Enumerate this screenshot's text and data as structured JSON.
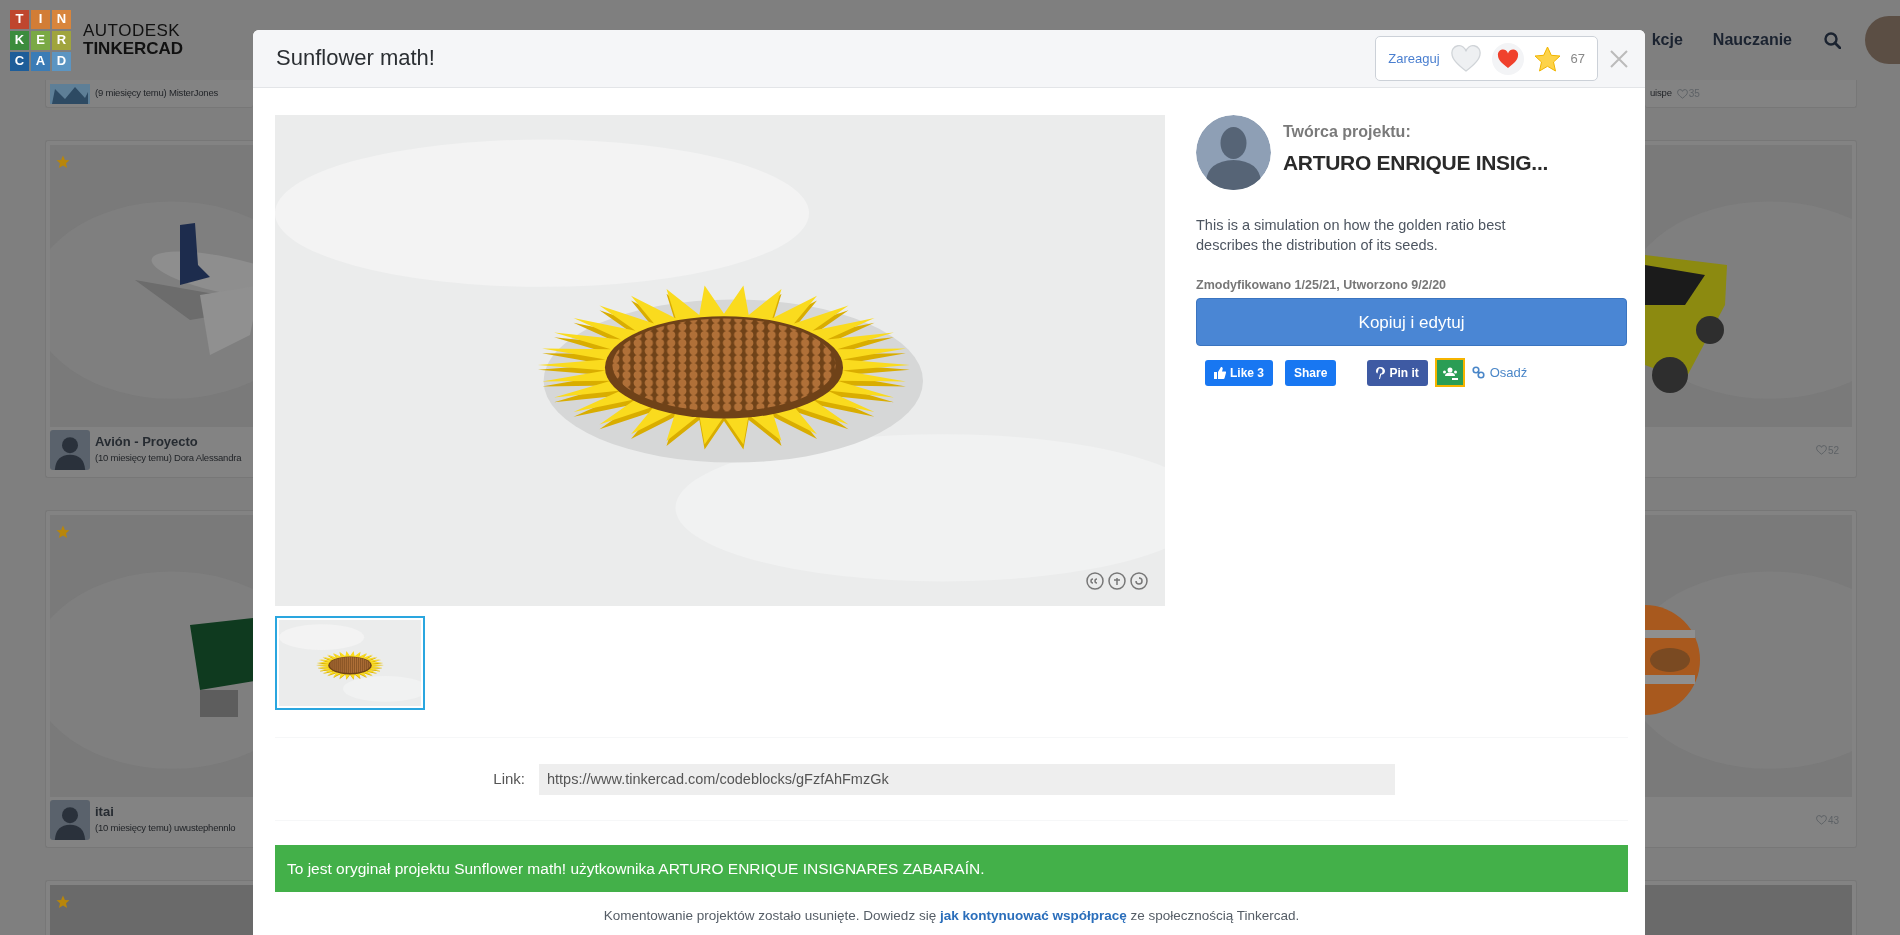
{
  "header": {
    "logo": {
      "tiles": [
        {
          "letter": "T",
          "color": "#bf462e"
        },
        {
          "letter": "I",
          "color": "#d27d36"
        },
        {
          "letter": "N",
          "color": "#d8853c"
        },
        {
          "letter": "K",
          "color": "#3c8c3d"
        },
        {
          "letter": "E",
          "color": "#7aa945"
        },
        {
          "letter": "R",
          "color": "#a0a43d"
        },
        {
          "letter": "C",
          "color": "#1e5d99"
        },
        {
          "letter": "A",
          "color": "#3b7cb6"
        },
        {
          "letter": "D",
          "color": "#5c95c2"
        }
      ],
      "brand": "AUTODESK",
      "product": "TINKERCAD"
    },
    "nav": [
      "kcje",
      "Nauczanie"
    ]
  },
  "gallery": {
    "left": [
      {
        "subtitle": "(9 miesięcy temu) MisterJones"
      },
      {
        "featured": true,
        "title": "Avión - Proyecto",
        "subtitle": "(10 miesięcy temu) Dora Alessandra"
      },
      {
        "featured": true,
        "title": "itai",
        "subtitle": "(10 miesięcy temu) uwustephennlo"
      },
      {
        "featured": true
      }
    ],
    "right": [
      {
        "subtitle": "uispe",
        "likes": "35"
      },
      {
        "likes": "52"
      },
      {
        "likes": "43"
      }
    ]
  },
  "modal": {
    "title": "Sunflower math!",
    "reactions": {
      "label": "Zareaguj",
      "count": "67"
    },
    "thumbnails": [
      {
        "selected": true
      }
    ],
    "creator": {
      "label": "Twórca projektu:",
      "name": "ARTURO ENRIQUE INSIG..."
    },
    "description": "This is a simulation on how the golden ratio best describes the distribution of its seeds.",
    "dates": "Zmodyfikowano 1/25/21, Utworzono 9/2/20",
    "primary_button": "Kopiuj i edytuj",
    "share": [
      {
        "kind": "like",
        "label": "Like 3"
      },
      {
        "kind": "share",
        "label": "Share"
      },
      {
        "kind": "pin",
        "label": "Pin it"
      },
      {
        "kind": "classroom"
      },
      {
        "kind": "embed",
        "label": "Osadź"
      }
    ],
    "link": {
      "label": "Link:",
      "value": "https://www.tinkercad.com/codeblocks/gFzfAhFmzGk"
    },
    "banner": "To jest oryginał projektu Sunflower math! użytkownika ARTURO ENRIQUE INSIGNARES ZABARAÍN.",
    "note": {
      "before": "Komentowanie projektów zostało usunięte. Dowiedz się",
      "link": "jak kontynuować współpracę",
      "after": "ze społecznością Tinkercad."
    }
  }
}
